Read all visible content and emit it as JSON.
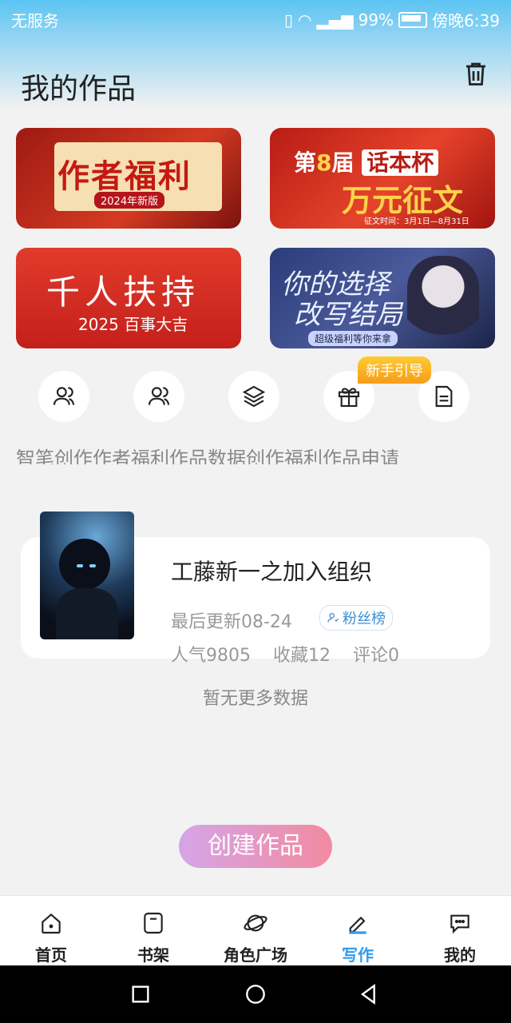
{
  "status_bar": {
    "carrier": "无服务",
    "battery": "99%",
    "time": "傍晚6:39"
  },
  "header": {
    "title": "我的作品"
  },
  "banners": [
    {
      "text": "作者福利",
      "sub": "2024年新版"
    },
    {
      "text1": "第",
      "text2": "8",
      "text3": "届",
      "text4": "话本杯",
      "big": "万元征文",
      "small": "征文时间：3月1日—8月31日"
    },
    {
      "text": "千人扶持",
      "sub": "2025 百事大吉"
    },
    {
      "line1": "你的选择",
      "line2": "改写结局",
      "sub": "超级福利等你来拿"
    }
  ],
  "shortcuts": {
    "labels": "智笔创作作者福利作品数据创作福利作品申请",
    "badge": "新手引导"
  },
  "work": {
    "title": "工藤新一之加入组织",
    "updated": "最后更新08-24",
    "fans_label": "粉丝榜",
    "popularity": "人气9805",
    "favorites": "收藏12",
    "comments": "评论0"
  },
  "no_more": "暂无更多数据",
  "create_button": "创建作品",
  "tabs": [
    {
      "label": "首页",
      "icon": "home-icon"
    },
    {
      "label": "书架",
      "icon": "bookshelf-icon"
    },
    {
      "label": "角色广场",
      "icon": "planet-icon"
    },
    {
      "label": "写作",
      "icon": "pen-icon",
      "active": true
    },
    {
      "label": "我的",
      "icon": "chat-icon"
    }
  ],
  "colors": {
    "accent": "#2e9cf0",
    "status_bar": "#5bc4f2",
    "create_start": "#d5a5e8",
    "create_end": "#f28aa0"
  }
}
